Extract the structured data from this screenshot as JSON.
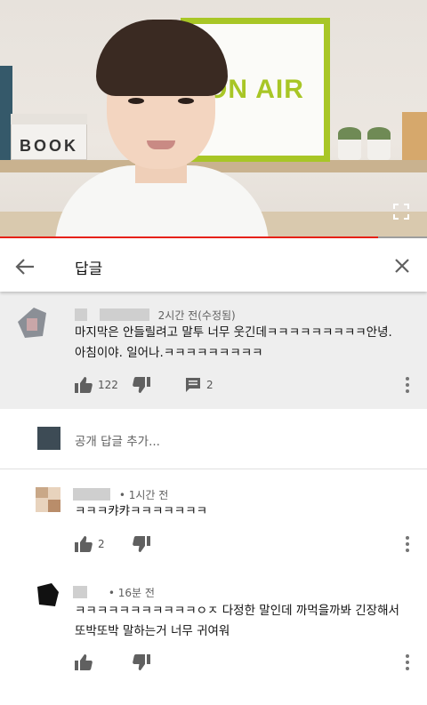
{
  "header": {
    "title": "답글"
  },
  "video": {
    "sign_text": "ON AIR",
    "book_text": "BOOK",
    "progress": 0.885
  },
  "parent_comment": {
    "time": "2시간 전(수정됨)",
    "text_line1": "마지막은 안들릴려고 말투 너무 웃긴데ㅋㅋㅋㅋㅋㅋㅋㅋㅋ안녕.",
    "text_line2": "아침이야. 일어나.ㅋㅋㅋㅋㅋㅋㅋㅋㅋ",
    "likes": "122",
    "replies": "2"
  },
  "add_reply": {
    "placeholder": "공개 답글 추가..."
  },
  "replies": [
    {
      "time": "• 1시간 전",
      "text_line1": "ㅋㅋㅋ캬캬ㅋㅋㅋㅋㅋㅋㅋ",
      "text_line2": "",
      "likes": "2"
    },
    {
      "time": "• 16분 전",
      "text_line1": "ㅋㅋㅋㅋㅋㅋㅋㅋㅋㅋㅋㅇㅈ 다정한 말인데 까먹을까봐 긴장해서",
      "text_line2": "또박또박 말하는거 너무 귀여워",
      "likes": ""
    }
  ],
  "colors": {
    "accent": "#e62117",
    "sign_green": "#a8c626",
    "parent_bg": "#eeeeee"
  },
  "icons": [
    "back-arrow-icon",
    "close-icon",
    "fullscreen-icon",
    "thumb-up-icon",
    "thumb-down-icon",
    "comment-icon",
    "more-vert-icon"
  ]
}
